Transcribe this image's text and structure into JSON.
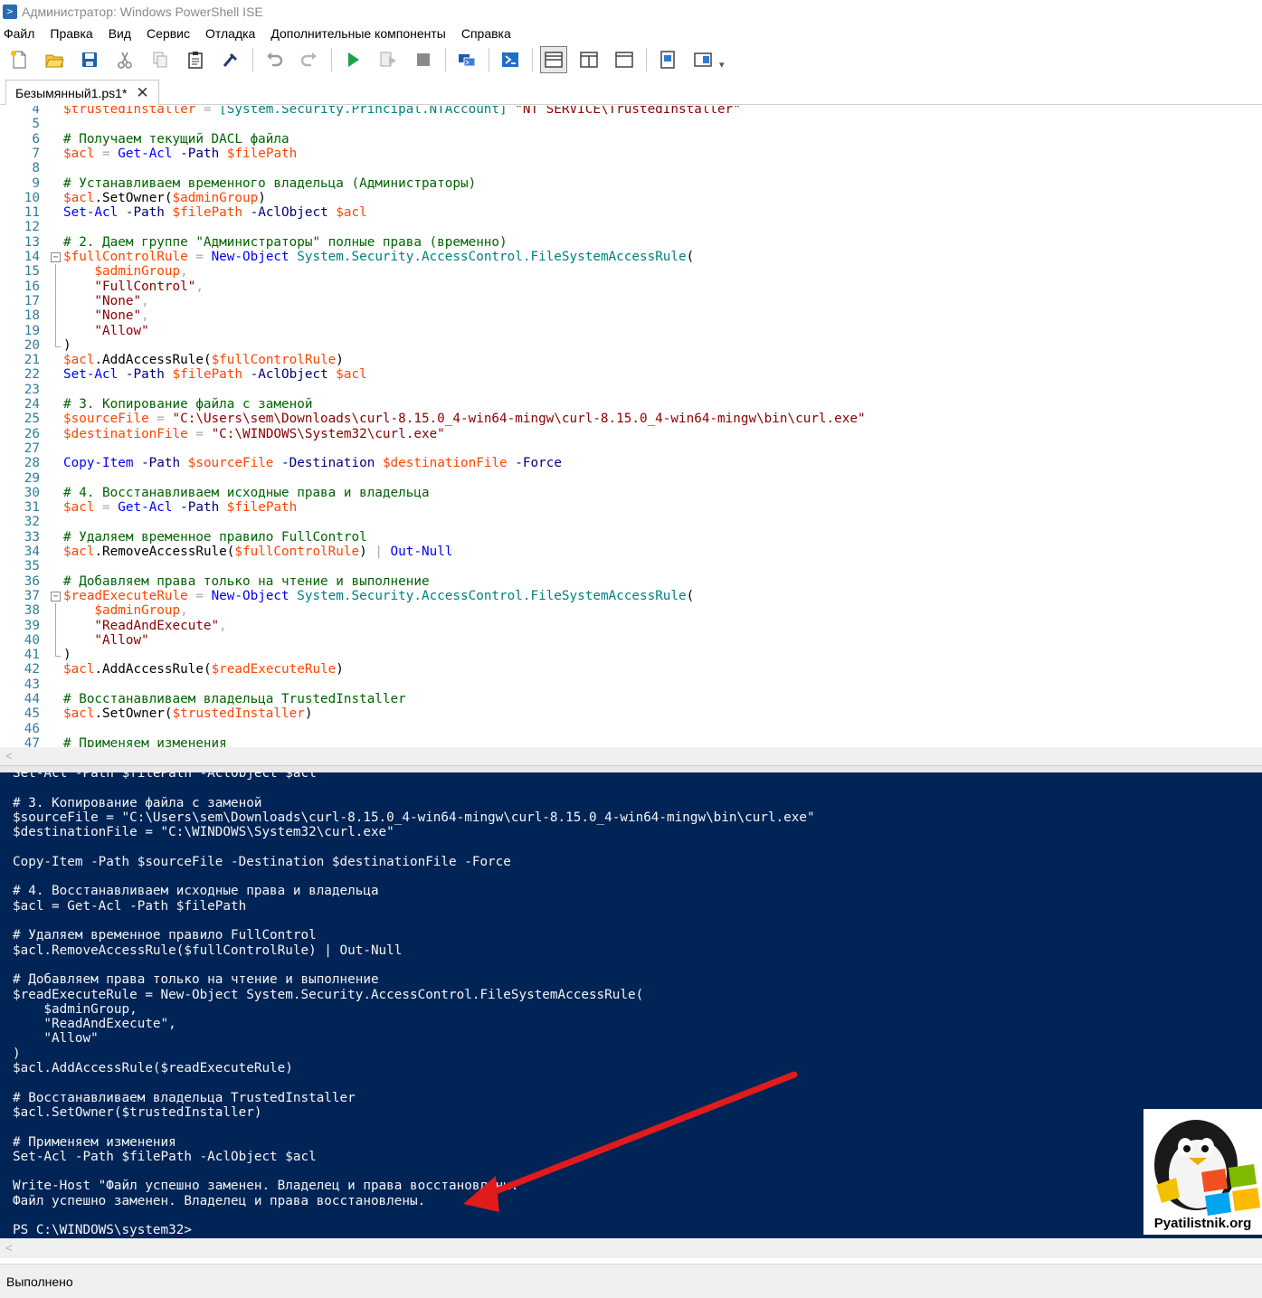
{
  "window": {
    "title": "Администратор: Windows PowerShell ISE",
    "icon": "powershell-icon"
  },
  "menu": [
    "Файл",
    "Правка",
    "Вид",
    "Сервис",
    "Отладка",
    "Дополнительные компоненты",
    "Справка"
  ],
  "toolbar": {
    "buttons": [
      {
        "name": "new-icon"
      },
      {
        "name": "open-icon"
      },
      {
        "name": "save-icon"
      },
      {
        "name": "cut-icon"
      },
      {
        "name": "copy-icon"
      },
      {
        "name": "paste-icon"
      },
      {
        "name": "clear-console-icon"
      },
      {
        "name": "undo-icon"
      },
      {
        "name": "redo-icon"
      },
      {
        "name": "run-icon"
      },
      {
        "name": "run-selection-icon"
      },
      {
        "name": "stop-icon"
      },
      {
        "name": "remote-powershell-icon"
      },
      {
        "name": "start-powershell-icon"
      },
      {
        "name": "show-script-top-icon"
      },
      {
        "name": "show-script-right-icon"
      },
      {
        "name": "show-script-maximized-icon"
      },
      {
        "name": "show-command-window-icon"
      },
      {
        "name": "show-command-addon-icon"
      }
    ]
  },
  "tab": {
    "label": "Безымянный1.ps1*",
    "close": "✕"
  },
  "editor": {
    "lines": [
      {
        "n": "4",
        "t": [
          [
            "var",
            "$trustedInstaller"
          ],
          [
            "op",
            " = "
          ],
          [
            "type",
            "[System.Security.Principal.NTAccount]"
          ],
          [
            "str",
            " \"NT SERVICE\\TrustedInstaller\""
          ]
        ]
      },
      {
        "n": "5",
        "t": []
      },
      {
        "n": "6",
        "t": [
          [
            "com",
            "# Получаем текущий DACL файла"
          ]
        ]
      },
      {
        "n": "7",
        "t": [
          [
            "var",
            "$acl"
          ],
          [
            "op",
            " = "
          ],
          [
            "cmd",
            "Get-Acl"
          ],
          [
            "par",
            " -Path "
          ],
          [
            "var",
            "$filePath"
          ]
        ]
      },
      {
        "n": "8",
        "t": []
      },
      {
        "n": "9",
        "t": [
          [
            "com",
            "# Устанавливаем временного владельца (Администраторы)"
          ]
        ]
      },
      {
        "n": "10",
        "t": [
          [
            "var",
            "$acl"
          ],
          [
            "mem",
            ".SetOwner("
          ],
          [
            "var",
            "$adminGroup"
          ],
          [
            "mem",
            ")"
          ]
        ]
      },
      {
        "n": "11",
        "t": [
          [
            "cmd",
            "Set-Acl"
          ],
          [
            "par",
            " -Path "
          ],
          [
            "var",
            "$filePath"
          ],
          [
            "par",
            " -AclObject "
          ],
          [
            "var",
            "$acl"
          ]
        ]
      },
      {
        "n": "12",
        "t": []
      },
      {
        "n": "13",
        "t": [
          [
            "com",
            "# 2. Даем группе \"Администраторы\" полные права (временно)"
          ]
        ]
      },
      {
        "n": "14",
        "t": [
          [
            "var",
            "$fullControlRule"
          ],
          [
            "op",
            " = "
          ],
          [
            "cmd",
            "New-Object"
          ],
          [
            "type",
            " System.Security.AccessControl.FileSystemAccessRule"
          ],
          [
            "mem",
            "("
          ]
        ],
        "fold": "open"
      },
      {
        "n": "15",
        "t": [
          [
            "var",
            "    $adminGroup"
          ],
          [
            "op",
            ","
          ]
        ],
        "guide": true
      },
      {
        "n": "16",
        "t": [
          [
            "str",
            "    \"FullControl\""
          ],
          [
            "op",
            ","
          ]
        ],
        "guide": true
      },
      {
        "n": "17",
        "t": [
          [
            "str",
            "    \"None\""
          ],
          [
            "op",
            ","
          ]
        ],
        "guide": true
      },
      {
        "n": "18",
        "t": [
          [
            "str",
            "    \"None\""
          ],
          [
            "op",
            ","
          ]
        ],
        "guide": true
      },
      {
        "n": "19",
        "t": [
          [
            "str",
            "    \"Allow\""
          ]
        ],
        "guide": true
      },
      {
        "n": "20",
        "t": [
          [
            "mem",
            ")"
          ]
        ],
        "guide": "end"
      },
      {
        "n": "21",
        "t": [
          [
            "var",
            "$acl"
          ],
          [
            "mem",
            ".AddAccessRule("
          ],
          [
            "var",
            "$fullControlRule"
          ],
          [
            "mem",
            ")"
          ]
        ]
      },
      {
        "n": "22",
        "t": [
          [
            "cmd",
            "Set-Acl"
          ],
          [
            "par",
            " -Path "
          ],
          [
            "var",
            "$filePath"
          ],
          [
            "par",
            " -AclObject "
          ],
          [
            "var",
            "$acl"
          ]
        ]
      },
      {
        "n": "23",
        "t": []
      },
      {
        "n": "24",
        "t": [
          [
            "com",
            "# 3. Копирование файла с заменой"
          ]
        ]
      },
      {
        "n": "25",
        "t": [
          [
            "var",
            "$sourceFile"
          ],
          [
            "op",
            " = "
          ],
          [
            "str",
            "\"C:\\Users\\sem\\Downloads\\curl-8.15.0_4-win64-mingw\\curl-8.15.0_4-win64-mingw\\bin\\curl.exe\""
          ]
        ]
      },
      {
        "n": "26",
        "t": [
          [
            "var",
            "$destinationFile"
          ],
          [
            "op",
            " = "
          ],
          [
            "str",
            "\"C:\\WINDOWS\\System32\\curl.exe\""
          ]
        ]
      },
      {
        "n": "27",
        "t": []
      },
      {
        "n": "28",
        "t": [
          [
            "cmd",
            "Copy-Item"
          ],
          [
            "par",
            " -Path "
          ],
          [
            "var",
            "$sourceFile"
          ],
          [
            "par",
            " -Destination "
          ],
          [
            "var",
            "$destinationFile"
          ],
          [
            "par",
            " -Force"
          ]
        ]
      },
      {
        "n": "29",
        "t": []
      },
      {
        "n": "30",
        "t": [
          [
            "com",
            "# 4. Восстанавливаем исходные права и владельца"
          ]
        ]
      },
      {
        "n": "31",
        "t": [
          [
            "var",
            "$acl"
          ],
          [
            "op",
            " = "
          ],
          [
            "cmd",
            "Get-Acl"
          ],
          [
            "par",
            " -Path "
          ],
          [
            "var",
            "$filePath"
          ]
        ]
      },
      {
        "n": "32",
        "t": []
      },
      {
        "n": "33",
        "t": [
          [
            "com",
            "# Удаляем временное правило FullControl"
          ]
        ]
      },
      {
        "n": "34",
        "t": [
          [
            "var",
            "$acl"
          ],
          [
            "mem",
            ".RemoveAccessRule("
          ],
          [
            "var",
            "$fullControlRule"
          ],
          [
            "mem",
            ")"
          ],
          [
            "op",
            " | "
          ],
          [
            "cmd",
            "Out-Null"
          ]
        ]
      },
      {
        "n": "35",
        "t": []
      },
      {
        "n": "36",
        "t": [
          [
            "com",
            "# Добавляем права только на чтение и выполнение"
          ]
        ]
      },
      {
        "n": "37",
        "t": [
          [
            "var",
            "$readExecuteRule"
          ],
          [
            "op",
            " = "
          ],
          [
            "cmd",
            "New-Object"
          ],
          [
            "type",
            " System.Security.AccessControl.FileSystemAccessRule"
          ],
          [
            "mem",
            "("
          ]
        ],
        "fold": "open"
      },
      {
        "n": "38",
        "t": [
          [
            "var",
            "    $adminGroup"
          ],
          [
            "op",
            ","
          ]
        ],
        "guide": true
      },
      {
        "n": "39",
        "t": [
          [
            "str",
            "    \"ReadAndExecute\""
          ],
          [
            "op",
            ","
          ]
        ],
        "guide": true
      },
      {
        "n": "40",
        "t": [
          [
            "str",
            "    \"Allow\""
          ]
        ],
        "guide": true
      },
      {
        "n": "41",
        "t": [
          [
            "mem",
            ")"
          ]
        ],
        "guide": "end"
      },
      {
        "n": "42",
        "t": [
          [
            "var",
            "$acl"
          ],
          [
            "mem",
            ".AddAccessRule("
          ],
          [
            "var",
            "$readExecuteRule"
          ],
          [
            "mem",
            ")"
          ]
        ]
      },
      {
        "n": "43",
        "t": []
      },
      {
        "n": "44",
        "t": [
          [
            "com",
            "# Восстанавливаем владельца TrustedInstaller"
          ]
        ]
      },
      {
        "n": "45",
        "t": [
          [
            "var",
            "$acl"
          ],
          [
            "mem",
            ".SetOwner("
          ],
          [
            "var",
            "$trustedInstaller"
          ],
          [
            "mem",
            ")"
          ]
        ]
      },
      {
        "n": "46",
        "t": []
      },
      {
        "n": "47",
        "t": [
          [
            "com",
            "# Применяем изменения"
          ]
        ]
      }
    ]
  },
  "console": {
    "lines": [
      "Set-Acl -Path $filePath -AclObject $acl",
      "",
      "# 3. Копирование файла с заменой",
      "$sourceFile = \"C:\\Users\\sem\\Downloads\\curl-8.15.0_4-win64-mingw\\curl-8.15.0_4-win64-mingw\\bin\\curl.exe\"",
      "$destinationFile = \"C:\\WINDOWS\\System32\\curl.exe\"",
      "",
      "Copy-Item -Path $sourceFile -Destination $destinationFile -Force",
      "",
      "# 4. Восстанавливаем исходные права и владельца",
      "$acl = Get-Acl -Path $filePath",
      "",
      "# Удаляем временное правило FullControl",
      "$acl.RemoveAccessRule($fullControlRule) | Out-Null",
      "",
      "# Добавляем права только на чтение и выполнение",
      "$readExecuteRule = New-Object System.Security.AccessControl.FileSystemAccessRule(",
      "    $adminGroup,",
      "    \"ReadAndExecute\",",
      "    \"Allow\"",
      ")",
      "$acl.AddAccessRule($readExecuteRule)",
      "",
      "# Восстанавливаем владельца TrustedInstaller",
      "$acl.SetOwner($trustedInstaller)",
      "",
      "# Применяем изменения",
      "Set-Acl -Path $filePath -AclObject $acl",
      "",
      "Write-Host \"Файл успешно заменен. Владелец и права восстановлены.\"",
      "Файл успешно заменен. Владелец и права восстановлены.",
      "",
      "PS C:\\WINDOWS\\system32>"
    ]
  },
  "status": {
    "text": "Выполнено"
  },
  "watermark": {
    "text": "Pyatilistnik.org",
    "icon": "penguin-windows-logo"
  },
  "colors": {
    "console_bg": "#012456",
    "arrow": "#e11b1b",
    "comment": "#006400",
    "variable": "#ff4500",
    "command": "#0000ff",
    "string": "#8b0000",
    "type": "#008080"
  }
}
